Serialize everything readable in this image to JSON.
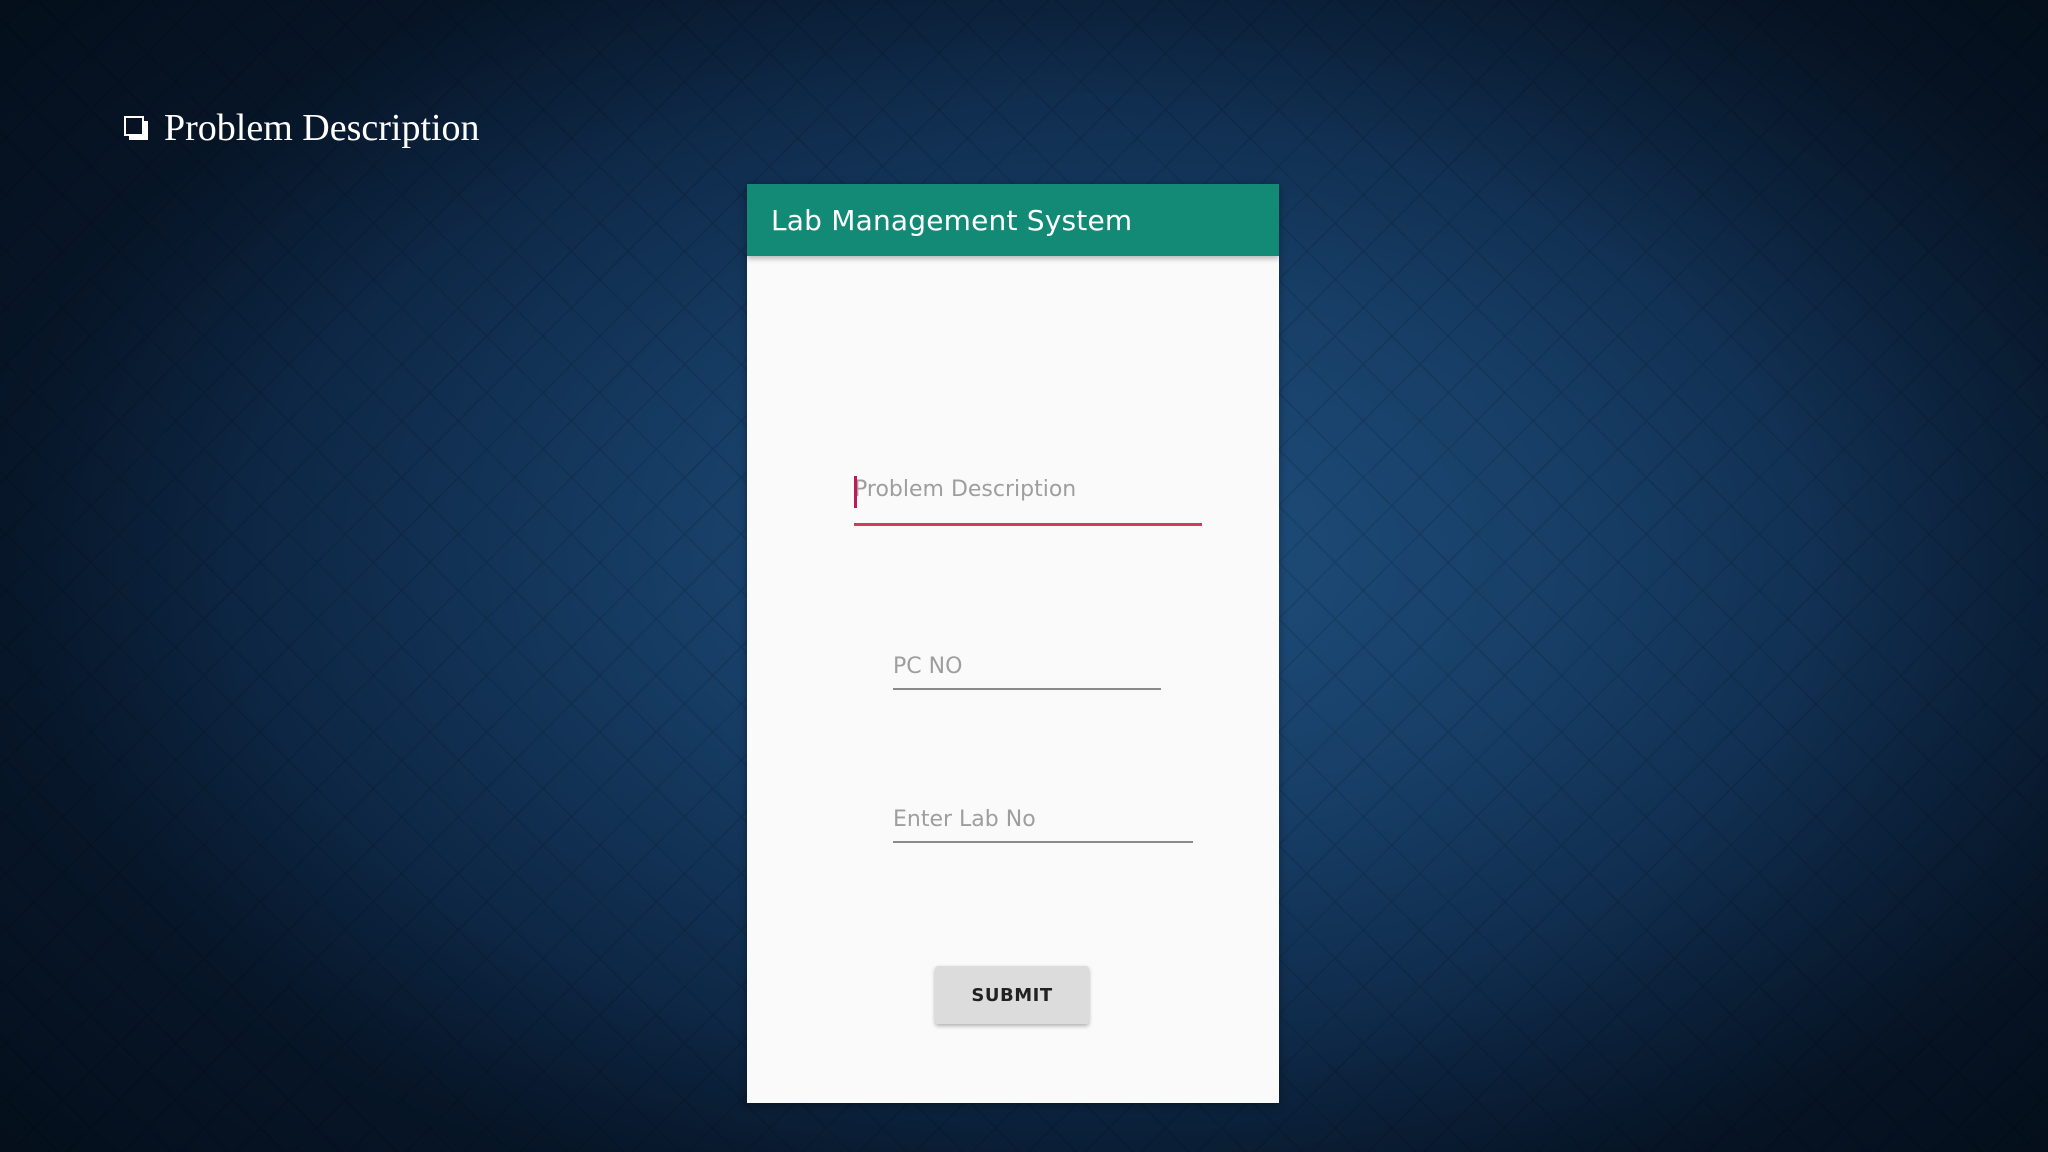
{
  "slide": {
    "heading": "Problem Description",
    "bullet_icon": "checkbox-square-icon"
  },
  "app": {
    "title": "Lab Management System",
    "accent_color": "#138a76",
    "focus_color": "#d9385e"
  },
  "form": {
    "problem_description": {
      "value": "",
      "placeholder": "Problem Description"
    },
    "pc_no": {
      "value": "",
      "placeholder": "PC NO"
    },
    "lab_no": {
      "value": "",
      "placeholder": "Enter Lab No"
    },
    "submit_label": "SUBMIT"
  }
}
